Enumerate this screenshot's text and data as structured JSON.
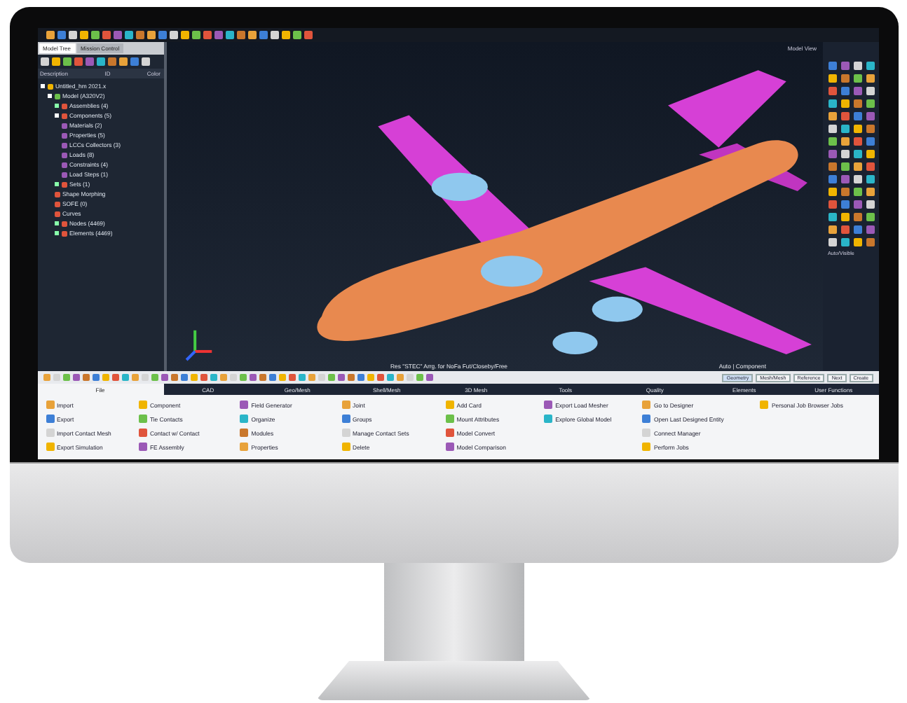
{
  "panel": {
    "tabs": [
      {
        "label": "Model Tree",
        "selected": true
      },
      {
        "label": "Mission Control",
        "selected": false
      }
    ],
    "columns": [
      "Description",
      "ID",
      "Color"
    ],
    "tree": [
      {
        "label": "Untitled_hm 2021.x",
        "expanded": true,
        "children": [
          {
            "label": "Model (A320V2)",
            "expanded": true,
            "children": [
              {
                "label": "Assemblies (4)",
                "expanded": false
              },
              {
                "label": "Components (5)",
                "expanded": true,
                "children": [
                  {
                    "label": "Materials (2)"
                  },
                  {
                    "label": "Properties (5)"
                  },
                  {
                    "label": "LCCs Collectors (3)"
                  },
                  {
                    "label": "Loads (8)"
                  },
                  {
                    "label": "Constraints (4)"
                  },
                  {
                    "label": "Load Steps (1)"
                  }
                ]
              },
              {
                "label": "Sets (1)",
                "expanded": false
              },
              {
                "label": "Shape Morphing"
              },
              {
                "label": "SOFE (0)"
              },
              {
                "label": "Curves"
              },
              {
                "label": "Nodes (4469)",
                "expanded": false
              },
              {
                "label": "Elements (4469)",
                "expanded": false
              }
            ]
          }
        ]
      }
    ]
  },
  "viewport": {
    "status": "Res \"STEC\" Arrg. for NoFa Fut/Closeby/Free",
    "mode": "Auto  |  Component",
    "view_label": "Model View"
  },
  "side_panel": {
    "search_label": "Auto/Visible"
  },
  "search_tabs": [
    {
      "label": "Geometry",
      "selected": true
    },
    {
      "label": "Mesh/Mesh",
      "selected": false
    },
    {
      "label": "Reference",
      "selected": false
    },
    {
      "label": "Next",
      "selected": false
    },
    {
      "label": "Create",
      "selected": false
    }
  ],
  "ribbon_tabs": [
    {
      "label": "File",
      "selected": true
    },
    {
      "label": "CAD",
      "selected": false
    },
    {
      "label": "Geo/Mesh",
      "selected": false
    },
    {
      "label": "Shell/Mesh",
      "selected": false
    },
    {
      "label": "3D Mesh",
      "selected": false
    },
    {
      "label": "Tools",
      "selected": false
    },
    {
      "label": "Quality",
      "selected": false
    },
    {
      "label": "Elements",
      "selected": false
    },
    {
      "label": "User Functions",
      "selected": false
    }
  ],
  "ribbon": [
    [
      "Import",
      "Export",
      "Import Contact Mesh",
      "Export Simulation"
    ],
    [
      "Component",
      "Tie Contacts",
      "Contact w/ Contact",
      "FE Assembly"
    ],
    [
      "Field Generator",
      "Organize",
      "Modules",
      "Properties"
    ],
    [
      "Joint",
      "Groups",
      "Manage Contact Sets",
      "Delete"
    ],
    [
      "Add Card",
      "Mount Attributes",
      "Model Convert",
      "Model Comparison"
    ],
    [
      "Export Load Mesher",
      "Explore Global Model"
    ],
    [
      "Go to Designer",
      "Open Last Designed Entity",
      "Connect Manager",
      "Perform Jobs"
    ],
    [
      "Personal Job Browser Jobs"
    ]
  ]
}
